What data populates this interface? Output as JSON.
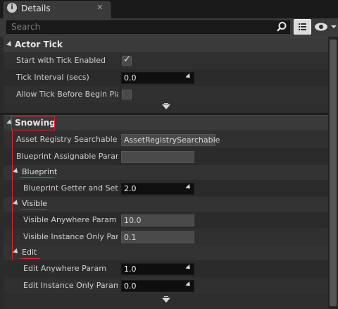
{
  "tab": {
    "title": "Details",
    "close": "✕"
  },
  "search": {
    "placeholder": "Search"
  },
  "sections": {
    "actor_tick": {
      "title": "Actor Tick",
      "rows": {
        "start_tick": {
          "label": "Start with Tick Enabled",
          "checked": true
        },
        "tick_interval": {
          "label": "Tick Interval (secs)",
          "value": "0.0"
        },
        "allow_tick": {
          "label": "Allow Tick Before Begin Play",
          "checked": false
        }
      }
    },
    "snowing": {
      "title": "Snowing",
      "rows": {
        "asset_registry": {
          "label": "Asset Registry Searchable Param",
          "value": "AssetRegistrySearchable"
        },
        "blueprint_assignable": {
          "label": "Blueprint Assignable Param",
          "value": ""
        }
      },
      "blueprint": {
        "title": "Blueprint",
        "rows": {
          "getter_setter": {
            "label": "Blueprint Getter and Setter",
            "value": "2.0"
          }
        }
      },
      "visible": {
        "title": "Visible",
        "rows": {
          "visible_anywhere": {
            "label": "Visible Anywhere Param",
            "value": "10.0"
          },
          "visible_instance": {
            "label": "Visible Instance Only Param",
            "value": "0.1"
          }
        }
      },
      "edit": {
        "title": "Edit",
        "rows": {
          "edit_anywhere": {
            "label": "Edit Anywhere Param",
            "value": "1.0"
          },
          "edit_instance": {
            "label": "Edit Instance Only Param",
            "value": "0.0"
          }
        }
      }
    }
  },
  "colors": {
    "annotation": "#e0232d",
    "background": "#2b2b2b",
    "header": "#3a3a3a"
  },
  "icons": [
    "info-icon",
    "close-icon",
    "search-icon",
    "list-view-icon",
    "eye-icon",
    "collapse-arrow-icon",
    "advanced-expand-icon",
    "drag-handle-icon",
    "checkmark-icon"
  ]
}
